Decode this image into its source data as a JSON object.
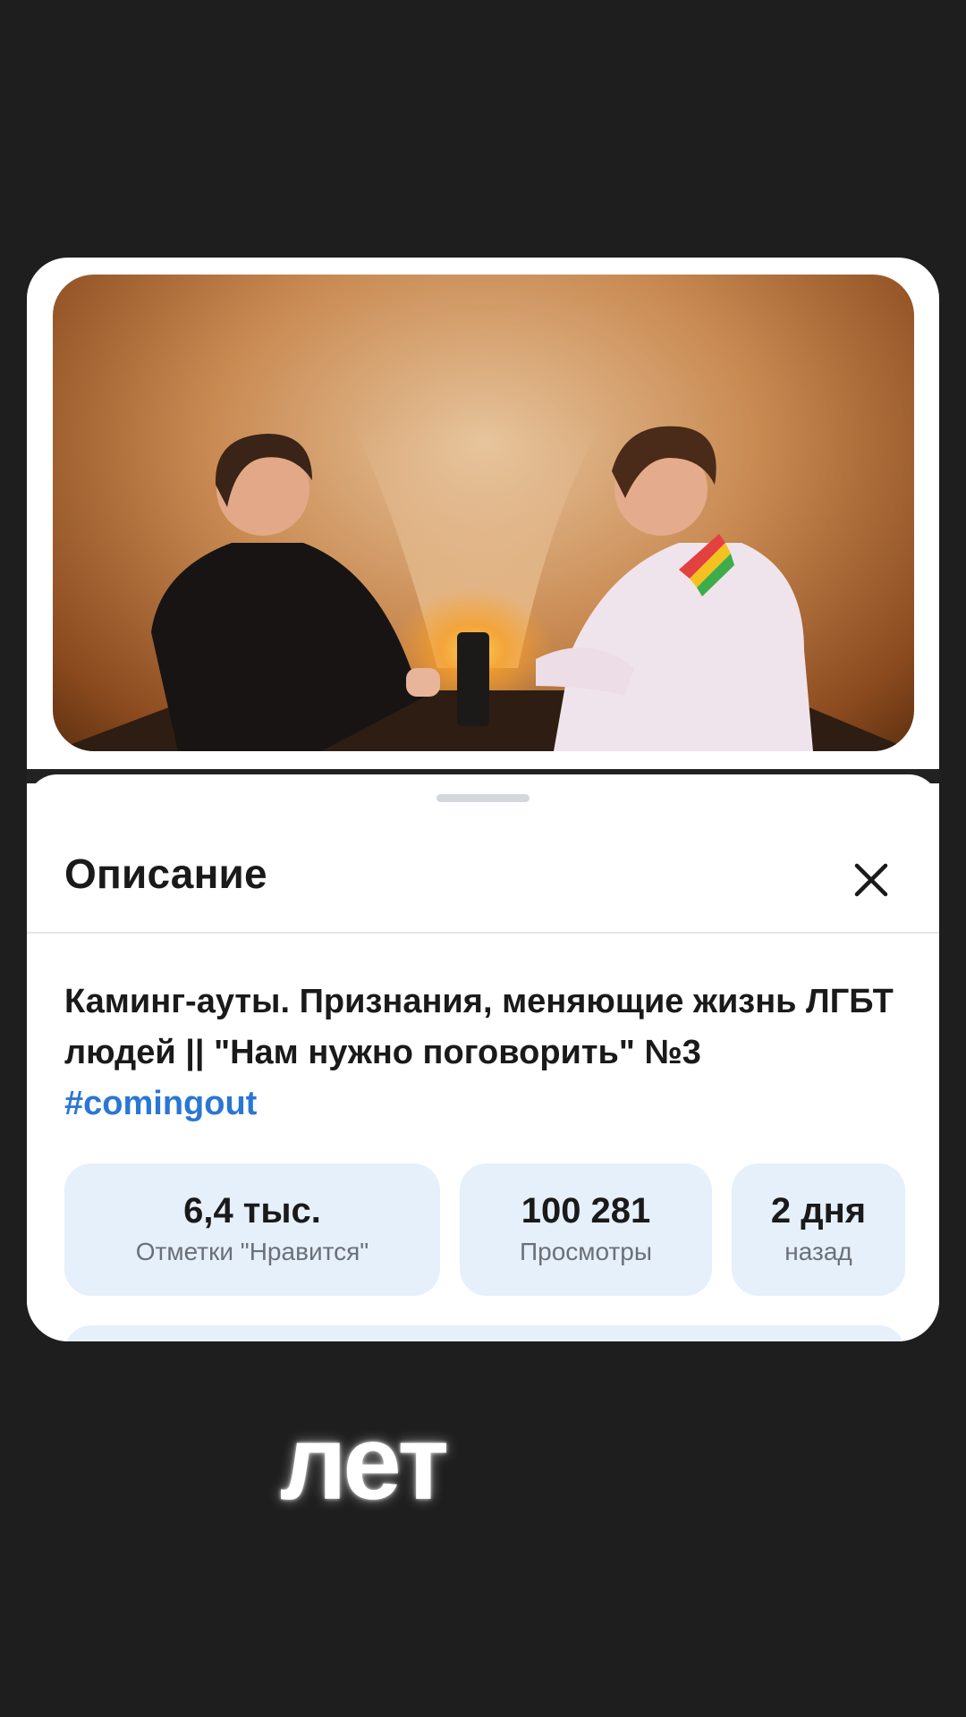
{
  "sheet": {
    "title": "Описание",
    "close_icon": "close-icon"
  },
  "video": {
    "title": "Каминг-ауты. Признания, меняющие жизнь ЛГБТ людей || \"Нам нужно поговорить\" №3",
    "hashtag": "#comingout"
  },
  "stats": {
    "likes": {
      "value": "6,4 тыс.",
      "label": "Отметки \"Нравится\""
    },
    "views": {
      "value": "100 281",
      "label": "Просмотры"
    },
    "date": {
      "value": "2 дня",
      "label": "назад"
    }
  },
  "caption": "лет",
  "colors": {
    "background": "#1e1e1e",
    "accent_link": "#2a76d4",
    "stat_chip": "#e6f0fa"
  }
}
